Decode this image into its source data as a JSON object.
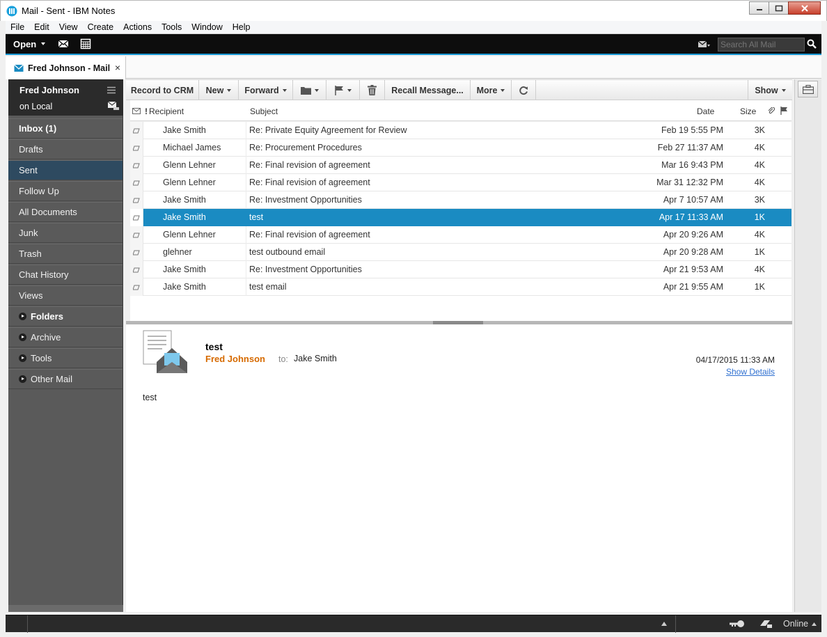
{
  "window": {
    "title": "Mail - Sent - IBM Notes"
  },
  "menu": [
    "File",
    "Edit",
    "View",
    "Create",
    "Actions",
    "Tools",
    "Window",
    "Help"
  ],
  "topbar": {
    "open_label": "Open",
    "search_placeholder": "Search All Mail"
  },
  "tab": {
    "label": "Fred Johnson - Mail"
  },
  "sidebar": {
    "user": "Fred Johnson",
    "location": "on Local",
    "items": [
      {
        "label": "Inbox (1)"
      },
      {
        "label": "Drafts"
      },
      {
        "label": "Sent"
      },
      {
        "label": "Follow Up"
      },
      {
        "label": "All Documents"
      },
      {
        "label": "Junk"
      },
      {
        "label": "Trash"
      },
      {
        "label": "Chat History"
      },
      {
        "label": "Views"
      },
      {
        "label": "Folders"
      },
      {
        "label": "Archive"
      },
      {
        "label": "Tools"
      },
      {
        "label": "Other Mail"
      }
    ]
  },
  "toolbar": {
    "record_crm": "Record to CRM",
    "new": "New",
    "forward": "Forward",
    "recall": "Recall Message...",
    "more": "More",
    "show": "Show"
  },
  "list": {
    "columns": {
      "importance": "!",
      "recipient": "Recipient",
      "subject": "Subject",
      "date": "Date",
      "size": "Size"
    },
    "rows": [
      {
        "recipient": "Jake Smith",
        "subject": "Re: Private Equity Agreement for Review",
        "date": "Feb 19   5:55 PM",
        "size": "3K"
      },
      {
        "recipient": "Michael James",
        "subject": "Re: Procurement Procedures",
        "date": "Feb 27 11:37 AM",
        "size": "4K"
      },
      {
        "recipient": "Glenn Lehner",
        "subject": "Re: Final revision of agreement",
        "date": "Mar 16   9:43 PM",
        "size": "4K"
      },
      {
        "recipient": "Glenn Lehner",
        "subject": "Re: Final revision of agreement",
        "date": "Mar 31 12:32 PM",
        "size": "4K"
      },
      {
        "recipient": "Jake Smith",
        "subject": "Re: Investment Opportunities",
        "date": "Apr 7   10:57 AM",
        "size": "3K"
      },
      {
        "recipient": "Jake Smith",
        "subject": "test",
        "date": "Apr 17 11:33 AM",
        "size": "1K"
      },
      {
        "recipient": "Glenn Lehner",
        "subject": "Re: Final revision of agreement",
        "date": "Apr 20   9:26 AM",
        "size": "4K"
      },
      {
        "recipient": "glehner",
        "subject": "test outbound email",
        "date": "Apr 20   9:28 AM",
        "size": "1K"
      },
      {
        "recipient": "Jake Smith",
        "subject": "Re: Investment Opportunities",
        "date": "Apr 21   9:53 AM",
        "size": "4K"
      },
      {
        "recipient": "Jake Smith",
        "subject": "test email",
        "date": "Apr 21   9:55 AM",
        "size": "1K"
      }
    ]
  },
  "preview": {
    "subject": "test",
    "from": "Fred Johnson",
    "to_label": "to:",
    "to": "Jake Smith",
    "date": "04/17/2015 11:33 AM",
    "show_details": "Show Details",
    "body": "test"
  },
  "status": {
    "online": "Online"
  },
  "colors": {
    "selection": "#1a8bc2",
    "accent": "#1596d3",
    "from": "#d66a00",
    "sidebar_selected": "#2e4a60"
  }
}
